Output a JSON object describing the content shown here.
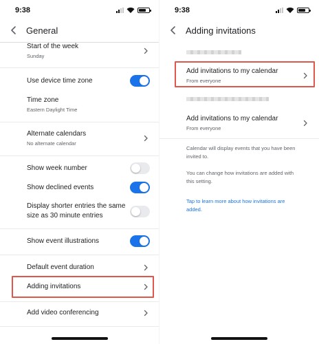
{
  "colors": {
    "accent": "#1a73e8",
    "highlight": "#e0564b"
  },
  "left": {
    "status_time": "9:38",
    "title": "General",
    "rows": {
      "start_week": {
        "label": "Start of the week",
        "value": "Sunday"
      },
      "device_tz": {
        "label": "Use device time zone",
        "toggle": true
      },
      "time_zone": {
        "label": "Time zone",
        "value": "Eastern Daylight Time"
      },
      "alt_calendars": {
        "label": "Alternate calendars",
        "value": "No alternate calendar"
      },
      "week_number": {
        "label": "Show week number",
        "toggle": false
      },
      "declined": {
        "label": "Show declined events",
        "toggle": true
      },
      "shorter_entries": {
        "label_line1": "Display shorter entries the same",
        "label_line2": "size as 30 minute entries",
        "toggle": false
      },
      "illustrations": {
        "label": "Show event illustrations",
        "toggle": true
      },
      "default_duration": {
        "label": "Default event duration"
      },
      "adding_invitations": {
        "label": "Adding invitations"
      },
      "video_conf": {
        "label": "Add video conferencing"
      }
    }
  },
  "right": {
    "status_time": "9:38",
    "title": "Adding invitations",
    "option1": {
      "label": "Add invitations to my calendar",
      "value": "From everyone"
    },
    "option2": {
      "label": "Add invitations to my calendar",
      "value": "From everyone"
    },
    "note1_line1": "Calendar will display events that you have been",
    "note1_line2": "invited to.",
    "note2_line1": "You can change how invitations are added with",
    "note2_line2": "this setting.",
    "link_line1": "Tap to learn more about how invitations are",
    "link_line2": "added."
  },
  "icons": {
    "back": "back-arrow-icon",
    "chevron": "chevron-right-icon",
    "signal": "cellular-signal-icon",
    "wifi": "wifi-icon",
    "battery": "battery-icon"
  }
}
